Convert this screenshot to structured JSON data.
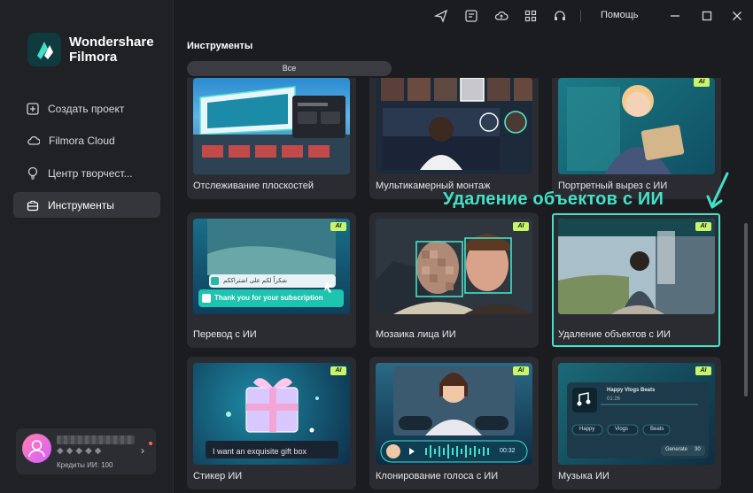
{
  "app": {
    "brand_line1": "Wondershare",
    "brand_line2": "Filmora"
  },
  "sidebar": {
    "items": [
      {
        "label": "Создать проект",
        "icon": "plus-square-icon"
      },
      {
        "label": "Filmora Cloud",
        "icon": "cloud-icon"
      },
      {
        "label": "Центр творчест...",
        "icon": "bulb-icon"
      },
      {
        "label": "Инструменты",
        "icon": "toolbox-icon"
      }
    ]
  },
  "account": {
    "credits": "Кредиты ИИ: 100",
    "arrow": "›"
  },
  "topbar": {
    "help": "Помощь"
  },
  "tools": {
    "title": "Инструменты",
    "filter_all": "Все",
    "ai_badge": "AI",
    "cards": [
      {
        "label": "Отслеживание плоскостей",
        "ai": false
      },
      {
        "label": "Мультикамерный монтаж",
        "ai": false
      },
      {
        "label": "Портретный вырез с ИИ",
        "ai": true
      },
      {
        "label": "Перевод с ИИ",
        "ai": true
      },
      {
        "label": "Мозаика лица ИИ",
        "ai": true
      },
      {
        "label": "Удаление объектов с ИИ",
        "ai": true
      },
      {
        "label": "Стикер ИИ",
        "ai": true
      },
      {
        "label": "Клонирование голоса с ИИ",
        "ai": true
      },
      {
        "label": "Музыка ИИ",
        "ai": true
      }
    ]
  },
  "callout": "Удаление объектов с ИИ",
  "thumbs": {
    "translate_top": "شكراً لكم على اشتراككم",
    "translate_bottom": "Thank you for your subscription",
    "sticker_prompt": "I want an exquisite gift box",
    "voice_time": "00:32",
    "music_title": "Happy Vlogs Beats",
    "music_time": "01:26",
    "music_tags": [
      "Happy",
      "Vlogs",
      "Beats"
    ],
    "music_generate": "Generate",
    "music_credits": "30",
    "mosaic_ai": "AI"
  },
  "colors": {
    "accent": "#44e0c8",
    "ai_badge": "#c8f56a",
    "background": "#1b1c20",
    "sidebar": "#202125",
    "card": "#2b2c31"
  }
}
